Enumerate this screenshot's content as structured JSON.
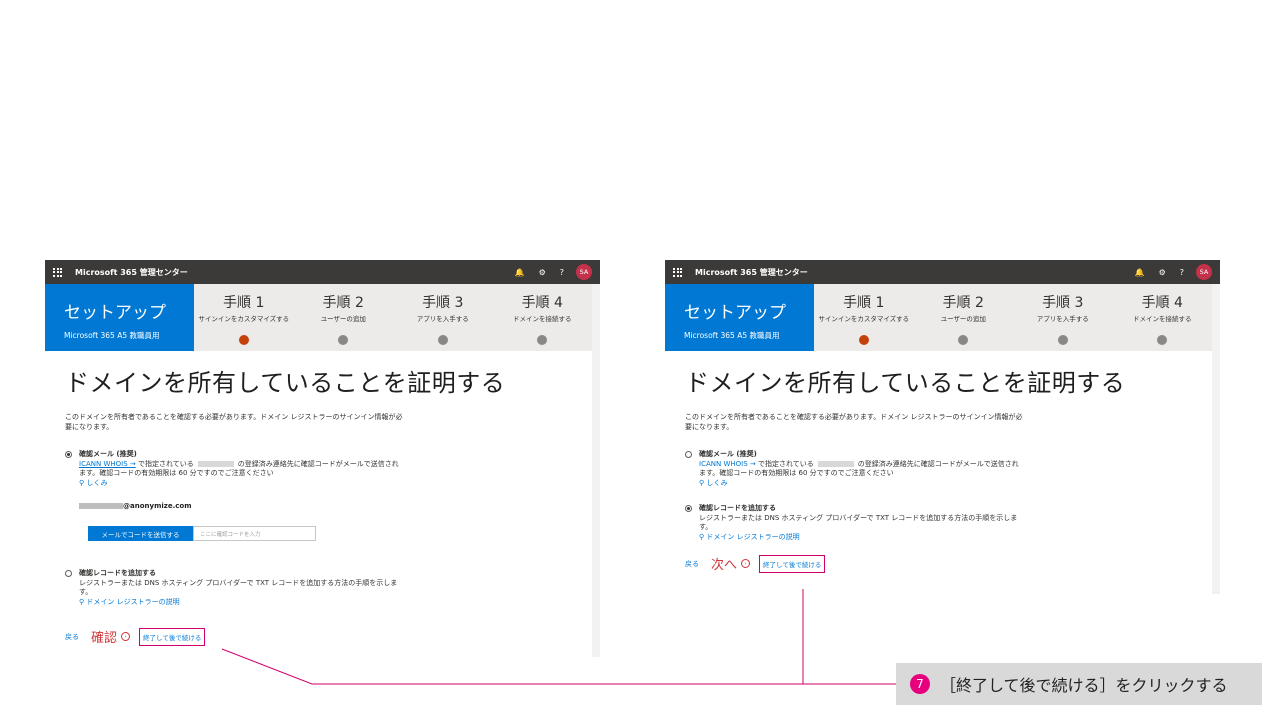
{
  "topbar": {
    "app_name": "Microsoft 365 管理センター",
    "bell_icon": "🔔",
    "gear_icon": "⚙",
    "help_icon": "?",
    "avatar": "SA"
  },
  "setup": {
    "title": "セットアップ",
    "subtitle": "Microsoft 365 A5 教職員用"
  },
  "steps": [
    {
      "label": "手順 1",
      "desc": "サインインをカスタマイズする",
      "state": "active"
    },
    {
      "label": "手順 2",
      "desc": "ユーザーの追加",
      "state": "pending"
    },
    {
      "label": "手順 3",
      "desc": "アプリを入手する",
      "state": "pending"
    },
    {
      "label": "手順 4",
      "desc": "ドメインを接続する",
      "state": "pending"
    }
  ],
  "page_title": "ドメインを所有していることを証明する",
  "intro": "このドメインを所有者であることを確認する必要があります。ドメイン レジストラーのサインイン情報が必要になります。",
  "email_option": {
    "title": "確認メール (推奨)",
    "whois_link": "ICANN WHOIS →",
    "text1": " で指定されている",
    "text2": "の登録済み連絡先に確認コードがメールで送信されます。確認コードの有効期限は 60 分ですのでご注意ください",
    "hint": "しくみ"
  },
  "email_address": "@anonymize.com",
  "send_button": "メールでコードを送信する",
  "code_placeholder": "ここに確認コードを入力",
  "txt_option": {
    "title": "確認レコードを追加する",
    "text": "レジストラーまたは DNS ホスティング プロバイダーで TXT レコードを追加する方法の手順を示します。",
    "hint": "ドメイン レジストラーの説明"
  },
  "footer_left": {
    "back": "戻る",
    "primary": "確認",
    "finish": "終了して後で続ける"
  },
  "footer_right": {
    "back": "戻る",
    "primary": "次へ",
    "finish": "終了して後で続ける"
  },
  "callout": {
    "number": "7",
    "text": "［終了して後で続ける］をクリックする"
  },
  "colors": {
    "accent": "#0078d4",
    "highlight": "#d0006f",
    "topbar": "#3b3a39"
  }
}
